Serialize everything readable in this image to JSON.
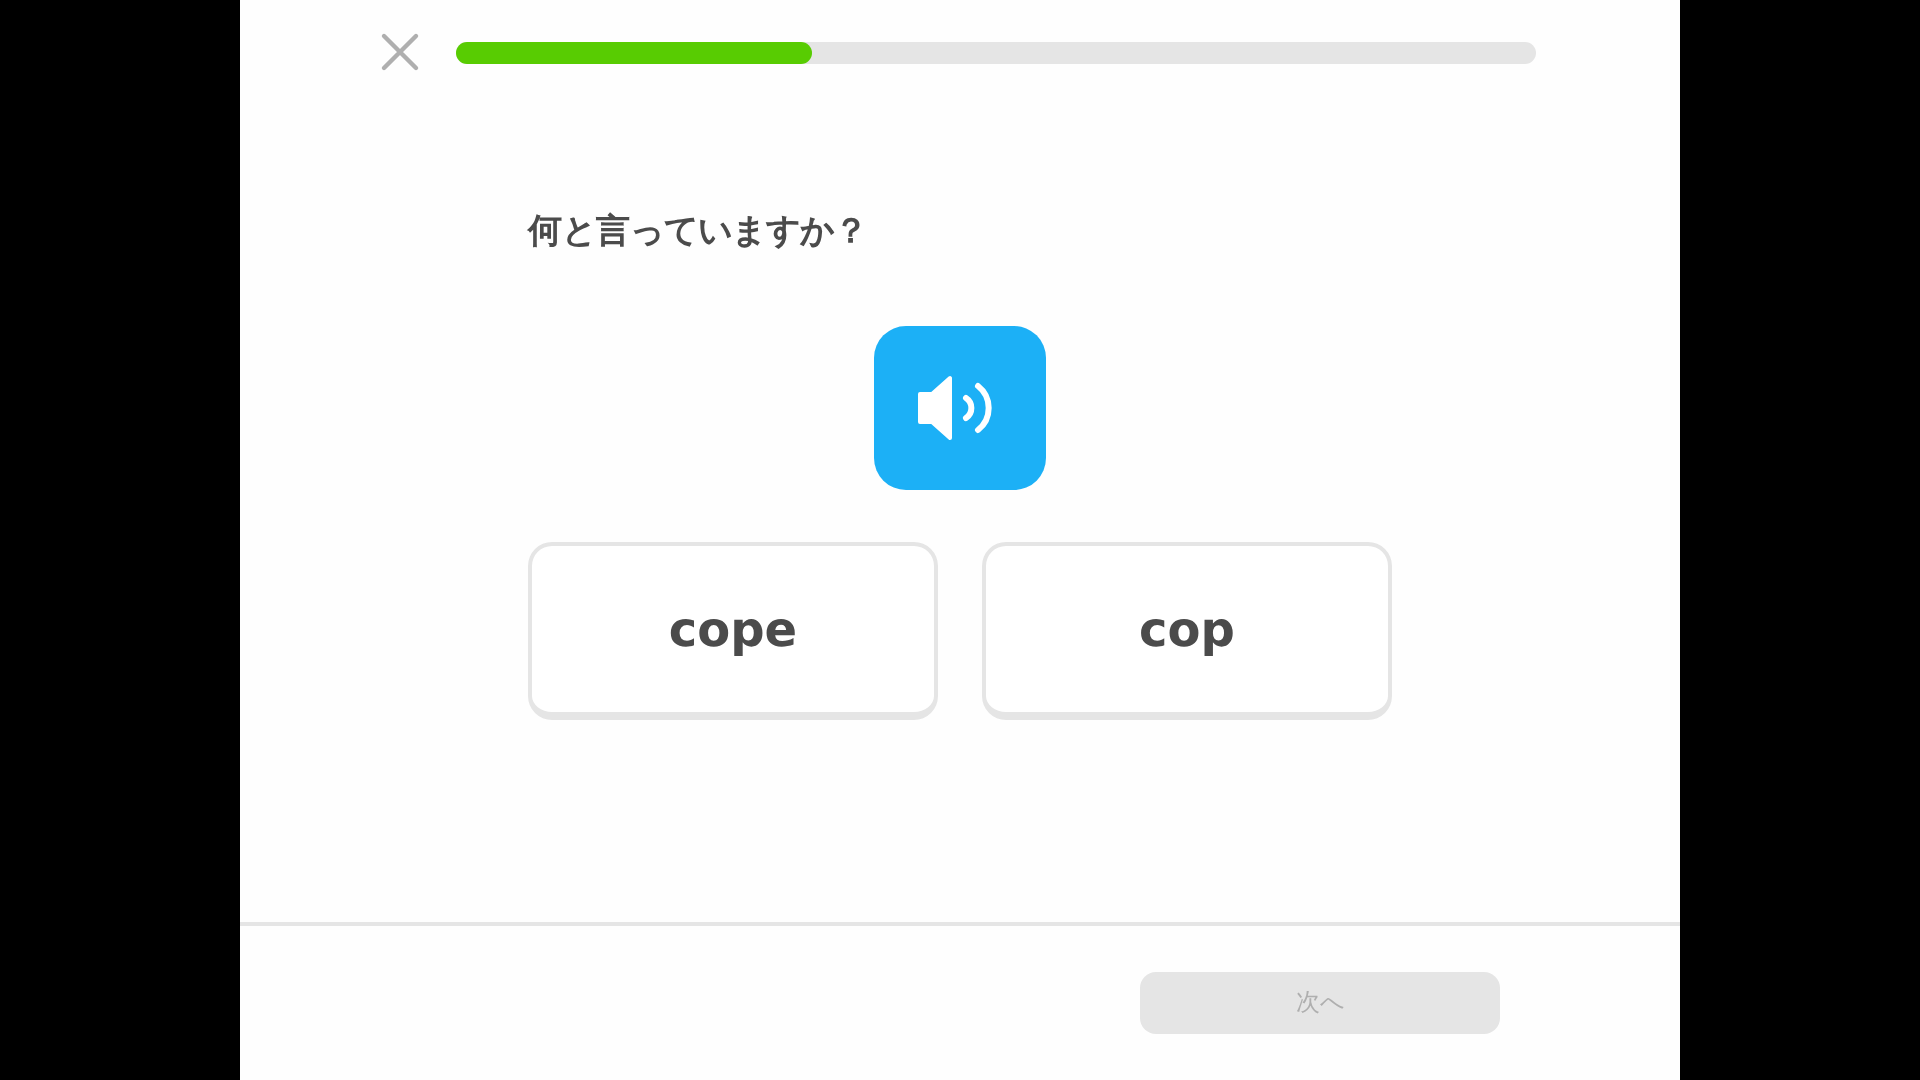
{
  "progress": {
    "level": 0.33
  },
  "prompt": "何と言っていますか？",
  "options": [
    {
      "label": "cope",
      "selected": false
    },
    {
      "label": "cop",
      "selected": false
    }
  ],
  "next_button": {
    "label": "次へ",
    "disabled": true
  }
}
